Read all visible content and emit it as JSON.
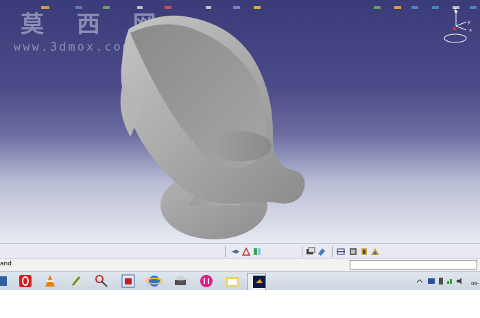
{
  "watermark": {
    "chinese": "莫 西 网",
    "url": "www.3dmox.com"
  },
  "compass": {
    "y_label": "y",
    "x_label": "x",
    "z_label": "z"
  },
  "command_bar": {
    "label": "and",
    "input_value": ""
  },
  "clock": {
    "text": "06-"
  },
  "colors": {
    "viewport_top": "#3a3b78",
    "viewport_bottom": "#e8ebf2",
    "model_gray": "#a8a8a8"
  },
  "bottom_toolbar_icons": [
    "fly-mode-icon",
    "normal-view-icon",
    "multi-view-icon",
    "hide-show-icon",
    "swap-visible-icon",
    "measure-icon",
    "apply-material-icon",
    "bill-of-material-icon",
    "render-icon"
  ],
  "taskbar_apps": [
    "app-icon",
    "opera-icon",
    "vlc-icon",
    "brush-icon",
    "snipping-icon",
    "media-icon",
    "internet-explorer-icon",
    "scanner-icon",
    "nero-icon",
    "folder-icon",
    "catia-icon"
  ]
}
